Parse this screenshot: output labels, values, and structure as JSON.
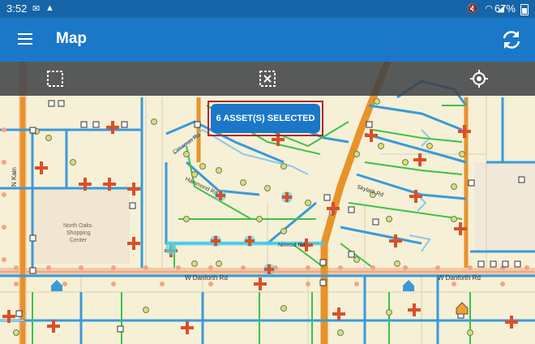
{
  "status_bar": {
    "time": "3:52",
    "battery": "67%",
    "left_icons": [
      "mail-icon",
      "drive-icon"
    ],
    "right_icons": [
      "mute-icon",
      "wifi-icon",
      "signal-icon",
      "battery-icon"
    ]
  },
  "app_bar": {
    "title": "Map",
    "menu_icon": "menu-icon",
    "refresh_icon": "refresh-icon",
    "color": "#1b78c8"
  },
  "toolbar": {
    "tools": [
      "select-rectangle-icon",
      "clear-selection-icon",
      "locate-icon"
    ]
  },
  "selection_toast": {
    "text": "6 ASSET(S) SELECTED"
  },
  "map": {
    "street_labels": {
      "n_kain": "N Kain",
      "w_danforth_1": "W Danforth Rd",
      "w_danforth_2": "W Danforth Rd",
      "nimrod": "Nimrod Rd",
      "diagonal": "Cimarron Rd",
      "hammond": "Hammond Rd",
      "northeast": "Skylark Rd"
    },
    "poi": {
      "line1": "North Oaks",
      "line2": "Shopping",
      "line3": "Center"
    },
    "colors": {
      "water_main": "#3a9ad9",
      "main_line": "#e8922a",
      "service_line": "#3cc24a",
      "hydrant": "#d8502a"
    }
  }
}
